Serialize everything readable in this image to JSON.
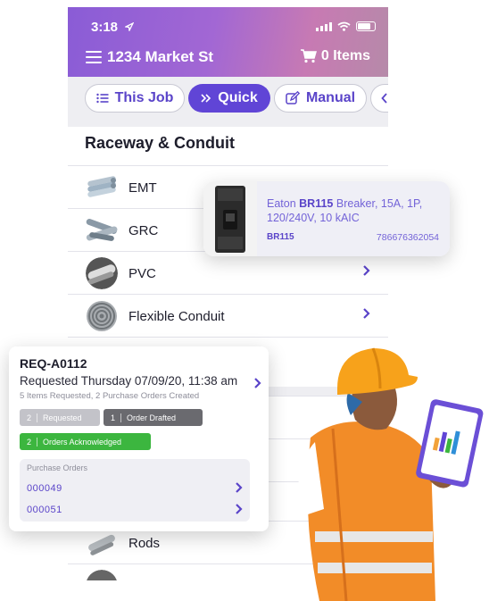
{
  "status_bar": {
    "time": "3:18"
  },
  "header": {
    "address": "1234 Market St",
    "cart_label": "0 Items"
  },
  "tabs": [
    {
      "label": "This Job",
      "icon": "list-icon"
    },
    {
      "label": "Quick",
      "icon": "double-chevron-icon"
    },
    {
      "label": "Manual",
      "icon": "edit-icon"
    }
  ],
  "section": {
    "title": "Raceway & Conduit"
  },
  "items": [
    {
      "label": "EMT"
    },
    {
      "label": "GRC"
    },
    {
      "label": "PVC"
    },
    {
      "label": "Flexible Conduit"
    },
    {
      "label": "Rods"
    }
  ],
  "product_popup": {
    "brand": "Eaton",
    "code": "BR115",
    "description": "Breaker, 15A, 1P, 120/240V, 10 kAIC",
    "upc": "786676362054"
  },
  "request_card": {
    "id": "REQ-A0112",
    "requested": "Requested Thursday 07/09/20, 11:38 am",
    "summary": "5 Items Requested, 2 Purchase Orders Created",
    "badges": [
      {
        "count": "2",
        "label": "Requested",
        "color": "#c3c3c9"
      },
      {
        "count": "1",
        "label": "Order Drafted",
        "color": "#6a6a6f"
      },
      {
        "count": "2",
        "label": "Orders Acknowledged",
        "color": "#3cb63f"
      }
    ],
    "purchase_orders_title": "Purchase Orders",
    "purchase_orders": [
      "000049",
      "000051"
    ]
  },
  "colors": {
    "accent": "#6045d6",
    "header_start": "#8a5cd6",
    "header_end": "#c77ab3"
  }
}
